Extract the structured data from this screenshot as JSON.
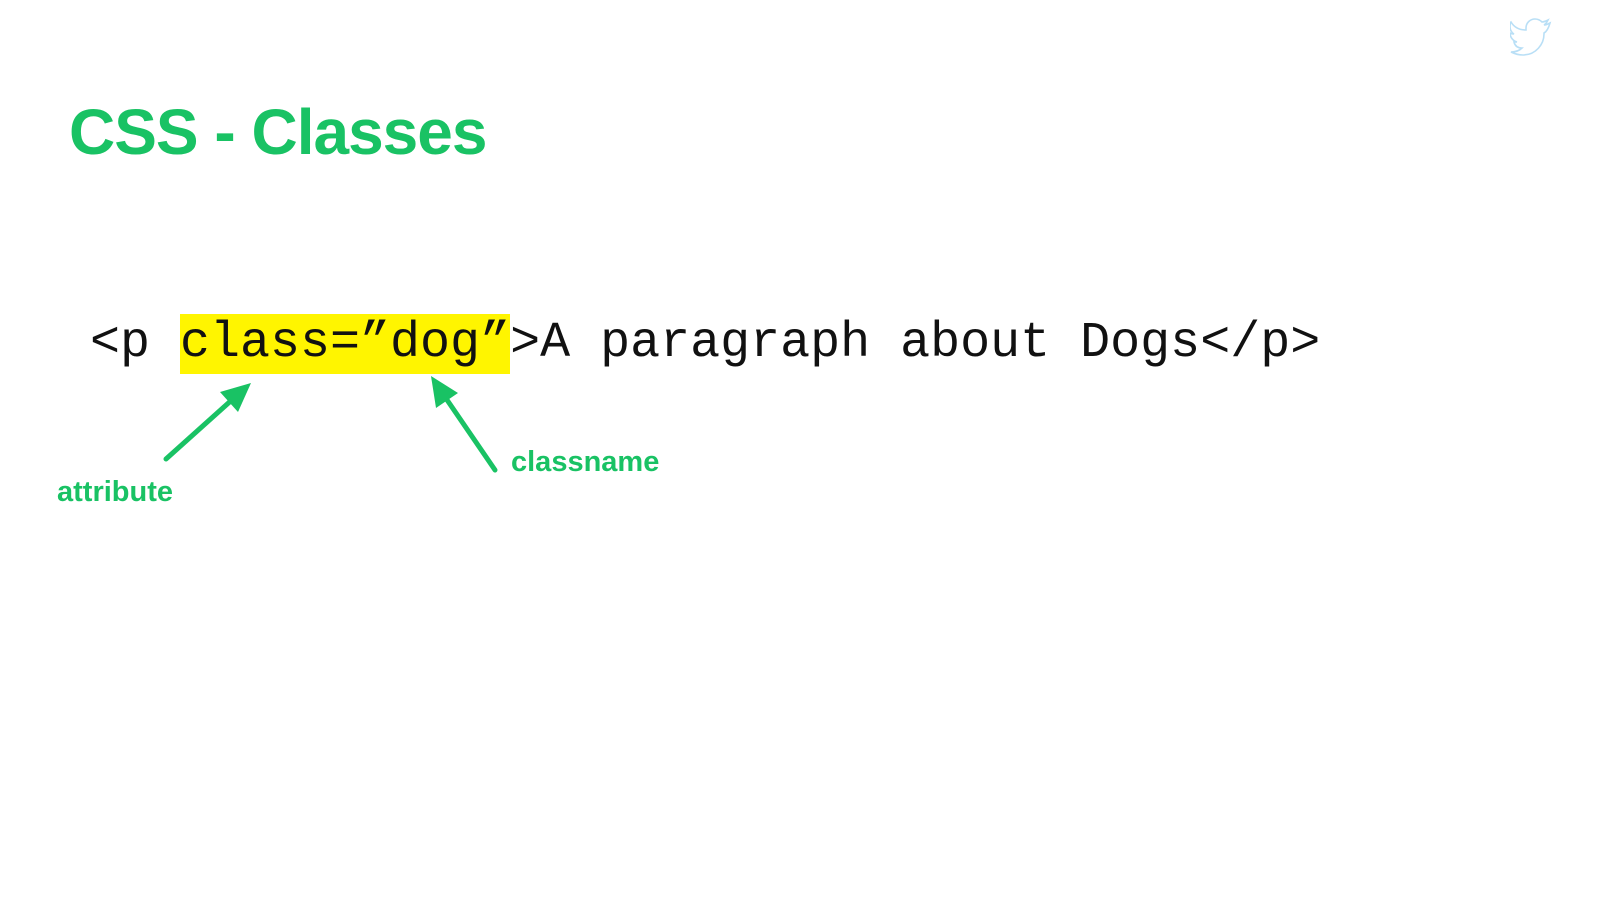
{
  "slide": {
    "title": "CSS - Classes",
    "code": {
      "open_tag": "<p ",
      "highlighted": "class=”dog”",
      "rest": ">A paragraph about Dogs</p>"
    },
    "annotations": {
      "attribute": "attribute",
      "classname": "classname"
    },
    "colors": {
      "accent": "#19c264",
      "highlight": "#fff500",
      "code_text": "#111111",
      "background": "#ffffff"
    },
    "icons": {
      "corner": "twitter-bird-icon"
    }
  }
}
